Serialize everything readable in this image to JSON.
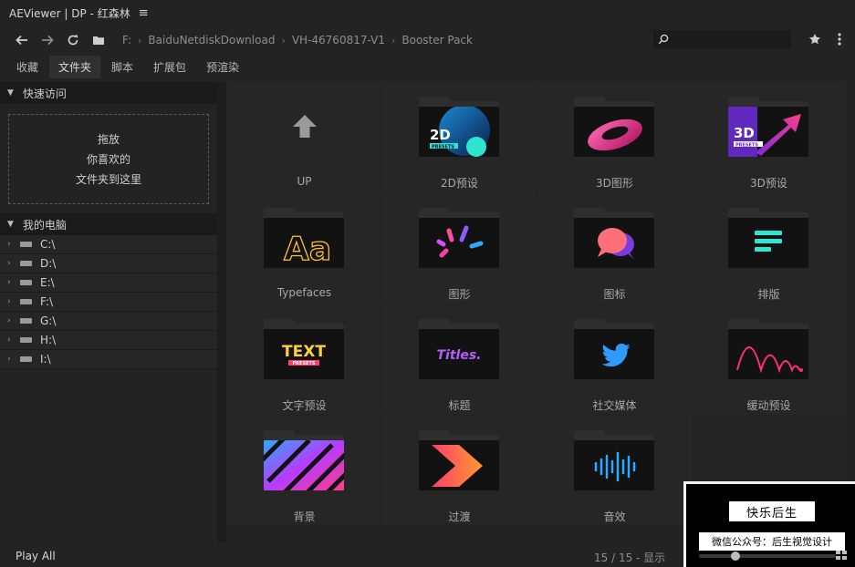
{
  "window": {
    "title": "AEViewer | DP - 红森林"
  },
  "breadcrumb": [
    "F:",
    "BaiduNetdiskDownload",
    "VH-46760817-V1",
    "Booster Pack"
  ],
  "search": {
    "placeholder": ""
  },
  "tabs": [
    "收藏",
    "文件夹",
    "脚本",
    "扩展包",
    "预渲染"
  ],
  "active_tab": "文件夹",
  "sidebar": {
    "quick_access_title": "快速访问",
    "dropzone_lines": [
      "拖放",
      "你喜欢的",
      "文件夹到这里"
    ],
    "my_computer_title": "我的电脑",
    "drives": [
      "C:\\",
      "D:\\",
      "E:\\",
      "F:\\",
      "G:\\",
      "H:\\",
      "I:\\"
    ]
  },
  "folders": [
    {
      "label": "UP",
      "icon": "up-arrow-icon"
    },
    {
      "label": "2D预设",
      "icon": "2d-presets-thumb",
      "thumb_text": "2D",
      "thumb_sub": "PRESETS"
    },
    {
      "label": "3D图形",
      "icon": "3d-shape-thumb"
    },
    {
      "label": "3D预设",
      "icon": "3d-presets-thumb",
      "thumb_text": "3D",
      "thumb_sub": "PRESETS"
    },
    {
      "label": "Typefaces",
      "icon": "typefaces-thumb",
      "thumb_text": "Aa"
    },
    {
      "label": "图形",
      "icon": "shapes-thumb"
    },
    {
      "label": "图标",
      "icon": "icons-thumb"
    },
    {
      "label": "排版",
      "icon": "layout-thumb"
    },
    {
      "label": "文字预设",
      "icon": "text-presets-thumb",
      "thumb_text": "TEXT",
      "thumb_sub": "PRESETS"
    },
    {
      "label": "标题",
      "icon": "titles-thumb",
      "thumb_text": "Titles."
    },
    {
      "label": "社交媒体",
      "icon": "social-media-thumb"
    },
    {
      "label": "缓动预设",
      "icon": "easing-presets-thumb"
    },
    {
      "label": "背景",
      "icon": "backgrounds-thumb"
    },
    {
      "label": "过渡",
      "icon": "transitions-thumb"
    },
    {
      "label": "音效",
      "icon": "sound-fx-thumb"
    }
  ],
  "statusbar": {
    "play_all": "Play All",
    "count": "15 / 15 - 显示"
  },
  "watermark": {
    "line1": "快乐后生",
    "line2": "微信公众号：后生视觉设计",
    "slider_value": 0.25
  },
  "colors": {
    "background": "#232323",
    "panel": "#262626",
    "accent_pink": "#ff4d9d",
    "accent_cyan": "#2ee6d0"
  }
}
